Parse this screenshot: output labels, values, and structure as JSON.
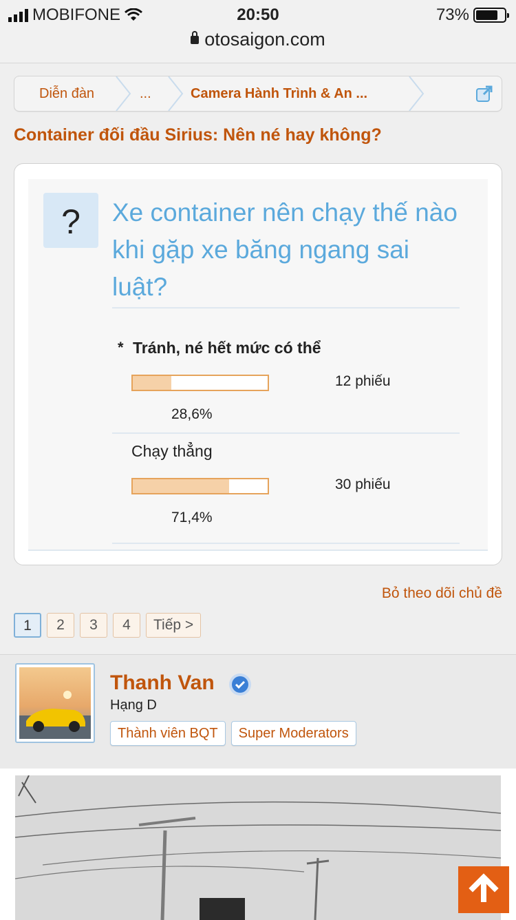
{
  "status_bar": {
    "carrier": "MOBIFONE",
    "time": "20:50",
    "battery": "73%",
    "battery_level": 0.73
  },
  "browser": {
    "url": "otosaigon.com"
  },
  "breadcrumb": {
    "items": [
      "Diễn đàn",
      "...",
      "Camera Hành Trình & An ..."
    ]
  },
  "thread": {
    "title": "Container đối đầu Sirius: Nên né hay không?"
  },
  "poll": {
    "question": "Xe container nên chạy thế nào khi gặp xe băng ngang sai luật?",
    "options": [
      {
        "marker": "*",
        "label": "Tránh, né hết mức có thể",
        "votes": "12 phiếu",
        "percent": "28,6%",
        "fraction": 0.286
      },
      {
        "label": "Chạy thẳng",
        "votes": "30 phiếu",
        "percent": "71,4%",
        "fraction": 0.714
      }
    ]
  },
  "actions": {
    "unfollow": "Bỏ theo dõi chủ đề"
  },
  "pagination": {
    "pages": [
      "1",
      "2",
      "3",
      "4"
    ],
    "current": "1",
    "next": "Tiếp >"
  },
  "post": {
    "author": "Thanh Van",
    "rank": "Hạng D",
    "badges": [
      "Thành viên BQT",
      "Super Moderators"
    ]
  },
  "colors": {
    "accent": "#c0550c",
    "link_blue": "#5ba9dc",
    "bar_fill": "#f6d1a8",
    "scroll_button": "#e35f14"
  }
}
